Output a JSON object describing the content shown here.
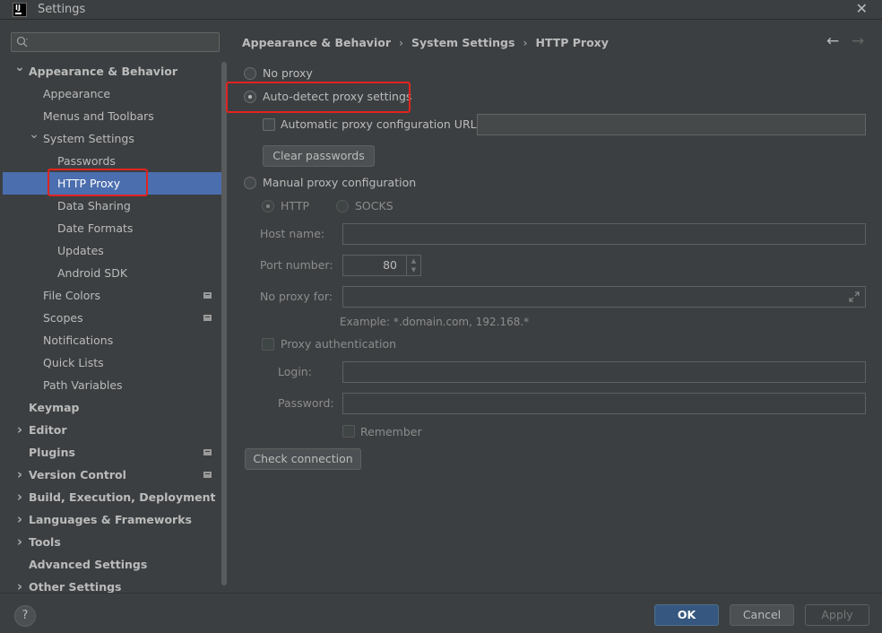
{
  "window": {
    "app_logo": "IJ",
    "title": "Settings",
    "close_glyph": "✕"
  },
  "sidebar": {
    "search_placeholder": "",
    "items": [
      {
        "label": "Appearance & Behavior",
        "bold": true,
        "expanded": true
      },
      {
        "label": "Appearance"
      },
      {
        "label": "Menus and Toolbars"
      },
      {
        "label": "System Settings",
        "expanded": true
      },
      {
        "label": "Passwords"
      },
      {
        "label": "HTTP Proxy",
        "selected": true
      },
      {
        "label": "Data Sharing"
      },
      {
        "label": "Date Formats"
      },
      {
        "label": "Updates"
      },
      {
        "label": "Android SDK"
      },
      {
        "label": "File Colors",
        "icon": "project-level-icon"
      },
      {
        "label": "Scopes",
        "icon": "project-level-icon"
      },
      {
        "label": "Notifications"
      },
      {
        "label": "Quick Lists"
      },
      {
        "label": "Path Variables"
      },
      {
        "label": "Keymap",
        "bold": true
      },
      {
        "label": "Editor",
        "bold": true,
        "collapsed": true
      },
      {
        "label": "Plugins",
        "bold": true,
        "icon": "project-level-icon"
      },
      {
        "label": "Version Control",
        "bold": true,
        "collapsed": true,
        "icon": "project-level-icon"
      },
      {
        "label": "Build, Execution, Deployment",
        "bold": true,
        "collapsed": true
      },
      {
        "label": "Languages & Frameworks",
        "bold": true,
        "collapsed": true
      },
      {
        "label": "Tools",
        "bold": true,
        "collapsed": true
      },
      {
        "label": "Advanced Settings",
        "bold": true
      },
      {
        "label": "Other Settings",
        "bold": true,
        "collapsed": true
      }
    ]
  },
  "breadcrumb": {
    "part1": "Appearance & Behavior",
    "part2": "System Settings",
    "part3": "HTTP Proxy",
    "sep": "›",
    "back": "←",
    "forward": "→"
  },
  "proxy": {
    "no_proxy": "No proxy",
    "auto_detect": "Auto-detect proxy settings",
    "auto_config_url": "Automatic proxy configuration URL:",
    "auto_config_value": "",
    "clear_passwords": "Clear passwords",
    "manual": "Manual proxy configuration",
    "http": "HTTP",
    "socks": "SOCKS",
    "host_label": "Host name:",
    "host_value": "",
    "port_label": "Port number:",
    "port_value": "80",
    "no_proxy_for_label": "No proxy for:",
    "no_proxy_for_value": "",
    "example": "Example: *.domain.com, 192.168.*",
    "proxy_auth": "Proxy authentication",
    "login_label": "Login:",
    "login_value": "",
    "password_label": "Password:",
    "password_value": "",
    "remember": "Remember",
    "check_connection": "Check connection",
    "selected_mode": "auto-detect"
  },
  "footer": {
    "help": "?",
    "ok": "OK",
    "cancel": "Cancel",
    "apply": "Apply"
  },
  "colors": {
    "background": "#3c3f41",
    "selection": "#4b6eaf",
    "primary_button": "#365880",
    "highlight": "#e0241f"
  }
}
